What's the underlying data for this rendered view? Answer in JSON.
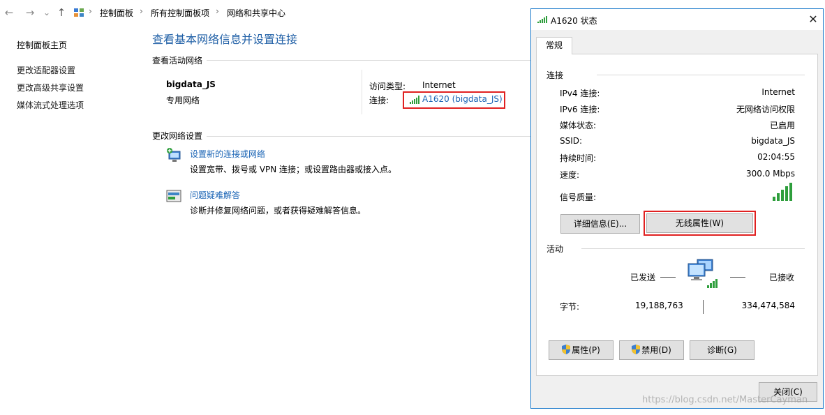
{
  "addressbar": {
    "back_icon": "←",
    "forward_icon": "→",
    "recent_icon": "⌄",
    "up_icon": "↑",
    "crumbs": [
      "控制面板",
      "所有控制面板项",
      "网络和共享中心"
    ],
    "sep": "›"
  },
  "left_nav": {
    "home": "控制面板主页",
    "items": [
      "更改适配器设置",
      "更改高级共享设置",
      "媒体流式处理选项"
    ]
  },
  "main": {
    "title": "查看基本网络信息并设置连接",
    "active_networks_label": "查看活动网络",
    "network_name": "bigdata_JS",
    "network_type": "专用网络",
    "access_type_label": "访问类型:",
    "access_type_value": "Internet",
    "connection_label": "连接:",
    "connection_link": "A1620 (bigdata_JS)",
    "change_settings_label": "更改网络设置",
    "tasks": [
      {
        "link": "设置新的连接或网络",
        "desc": "设置宽带、拨号或 VPN 连接；或设置路由器或接入点。"
      },
      {
        "link": "问题疑难解答",
        "desc": "诊断并修复网络问题，或者获得疑难解答信息。"
      }
    ]
  },
  "dialog": {
    "title": "A1620 状态",
    "close_icon": "✕",
    "tab": "常规",
    "connection_group": "连接",
    "rows": [
      {
        "label": "IPv4 连接:",
        "value": "Internet"
      },
      {
        "label": "IPv6 连接:",
        "value": "无网络访问权限"
      },
      {
        "label": "媒体状态:",
        "value": "已启用"
      },
      {
        "label": "SSID:",
        "value": "bigdata_JS"
      },
      {
        "label": "持续时间:",
        "value": "02:04:55"
      },
      {
        "label": "速度:",
        "value": "300.0 Mbps"
      }
    ],
    "signal_label": "信号质量:",
    "signal_level": 5,
    "details_button": "详细信息(E)...",
    "wireless_button": "无线属性(W)",
    "activity_group": "活动",
    "sent_label": "已发送",
    "received_label": "已接收",
    "bytes_label": "字节:",
    "bytes_sent": "19,188,763",
    "bytes_received": "334,474,584",
    "properties_button": "属性(P)",
    "disable_button": "禁用(D)",
    "diagnose_button": "诊断(G)",
    "close_button": "关闭(C)"
  },
  "watermark": "https://blog.csdn.net/MasterCayman",
  "colors": {
    "link": "#1a64b5",
    "title": "#1f5fa6",
    "highlight": "#e02020",
    "signal": "#2e9e3c",
    "dialog_border": "#1979ca"
  }
}
